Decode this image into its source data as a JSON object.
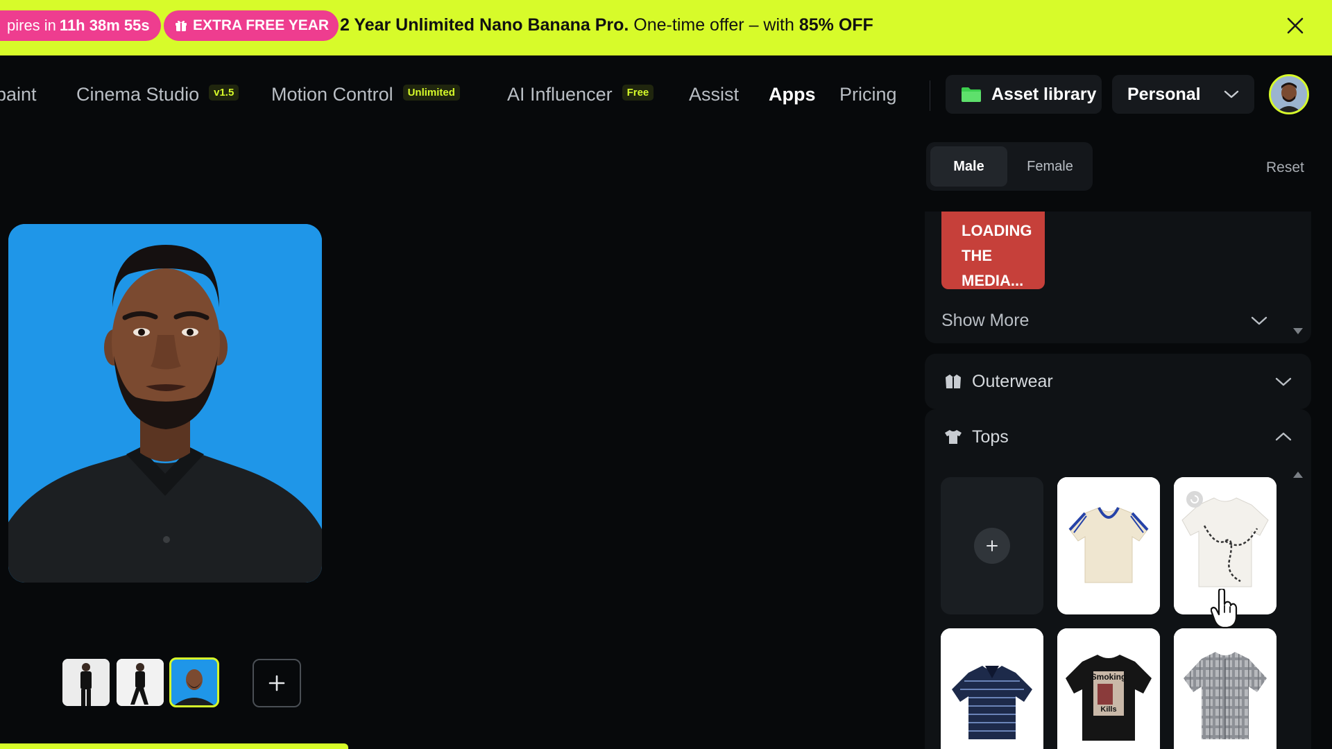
{
  "promo": {
    "timer_prefix": "pires in",
    "timer_value": "11h 38m 55s",
    "extra_label": "EXTRA FREE YEAR",
    "offer_bold": "2 Year Unlimited Nano Banana Pro.",
    "offer_text": "One-time offer – with",
    "offer_discount": "85% OFF",
    "accent": "#d7fb2a",
    "pill_color": "#ee3d8f"
  },
  "nav": {
    "items": [
      {
        "label": "paint",
        "badge": ""
      },
      {
        "label": "Cinema Studio",
        "badge": "v1.5"
      },
      {
        "label": "Motion Control",
        "badge": "Unlimited"
      },
      {
        "label": "AI Influencer",
        "badge": "Free"
      },
      {
        "label": "Assist",
        "badge": ""
      },
      {
        "label": "Apps",
        "badge": ""
      },
      {
        "label": "Pricing",
        "badge": ""
      }
    ],
    "active": "Apps",
    "asset_library": "Asset library",
    "workspace": "Personal"
  },
  "panel": {
    "gender_tabs": [
      "Male",
      "Female"
    ],
    "gender_selected": "Male",
    "reset": "Reset",
    "loading_lines": [
      "LOADING",
      "THE",
      "MEDIA..."
    ],
    "show_more": "Show More",
    "sections": {
      "outerwear": "Outerwear",
      "tops": "Tops"
    },
    "tops_items": [
      {
        "name": "add-custom"
      },
      {
        "name": "cream-polo-blue-trim"
      },
      {
        "name": "white-tee-chain-print"
      },
      {
        "name": "navy-striped-polo"
      },
      {
        "name": "black-graphic-tee-smoking-kills"
      },
      {
        "name": "gray-plaid-shirt"
      }
    ]
  },
  "preview": {
    "background": "#1f96e8",
    "thumbnails": [
      "black-outfit-standing",
      "black-outfit-walking",
      "portrait-blue-bg"
    ],
    "selected_thumbnail": "portrait-blue-bg"
  }
}
